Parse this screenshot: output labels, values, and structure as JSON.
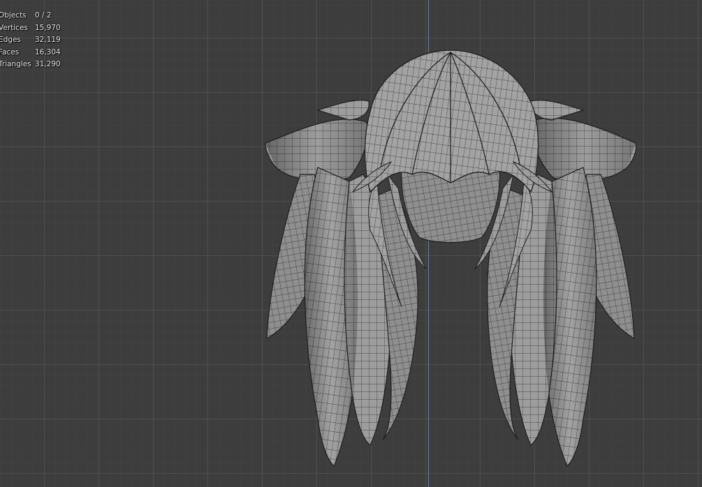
{
  "viewport": {
    "background_color": "#3d3d3d",
    "grid_color": "#5a5a5a",
    "axis_color": "#5b86c0",
    "mesh_color": "#9a9a9a",
    "wire_color": "#2a2a2a"
  },
  "stats": [
    {
      "label": "Objects",
      "value": "0 / 2"
    },
    {
      "label": "Vertices",
      "value": "15,970"
    },
    {
      "label": "Edges",
      "value": "32,119"
    },
    {
      "label": "Faces",
      "value": "16,304"
    },
    {
      "label": "Triangles",
      "value": "31,290"
    }
  ]
}
